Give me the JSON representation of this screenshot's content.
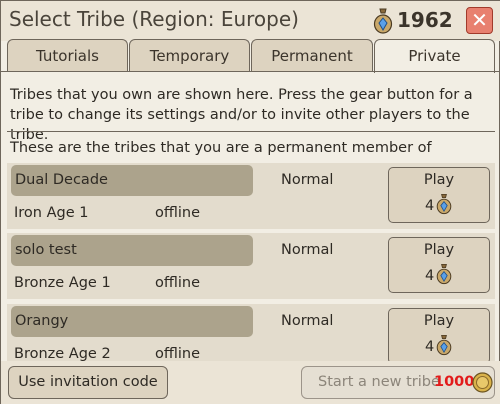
{
  "header": {
    "title": "Select Tribe (Region: Europe)",
    "coins": "1962",
    "close_label": "✕",
    "gem_icon": "gem-bag-icon"
  },
  "tabs": [
    {
      "label": "Tutorials",
      "active": false
    },
    {
      "label": "Temporary",
      "active": false
    },
    {
      "label": "Permanent",
      "active": false
    },
    {
      "label": "Private",
      "active": true
    }
  ],
  "intro_text": "Tribes that you own are shown here. Press the gear button for a tribe to change its settings and/or to invite other players to the tribe.",
  "section_title": "These are the tribes that you are a permanent member of",
  "tribes": [
    {
      "name": "Dual Decade",
      "age": "Iron Age 1",
      "status": "offline",
      "mode": "Normal",
      "play_label": "Play",
      "cost": "4"
    },
    {
      "name": "solo test",
      "age": "Bronze Age 1",
      "status": "offline",
      "mode": "Normal",
      "play_label": "Play",
      "cost": "4"
    },
    {
      "name": "Orangy",
      "age": "Bronze Age 2",
      "status": "offline",
      "mode": "Normal",
      "play_label": "Play",
      "cost": "4"
    }
  ],
  "footer": {
    "invite_label": "Use invitation code",
    "new_tribe_label": "Start a new tribe",
    "new_tribe_cost": "1000",
    "coin_icon": "gold-coin-icon"
  },
  "colors": {
    "close_bg": "#e8806f",
    "name_box": "#aca38c",
    "cost_red": "#e21b1b"
  }
}
